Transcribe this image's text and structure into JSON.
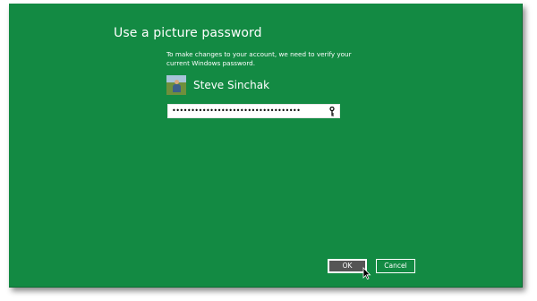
{
  "dialog": {
    "title": "Use a picture password",
    "description": "To make changes to your account, we need to verify your current Windows password.",
    "background_color": "#138a43"
  },
  "user": {
    "name": "Steve Sinchak",
    "avatar_icon": "user-photo"
  },
  "password": {
    "value": "••••••••••••••••••••••••••••••••••",
    "reveal_icon": "key-icon"
  },
  "buttons": {
    "ok_label": "OK",
    "cancel_label": "Cancel"
  }
}
